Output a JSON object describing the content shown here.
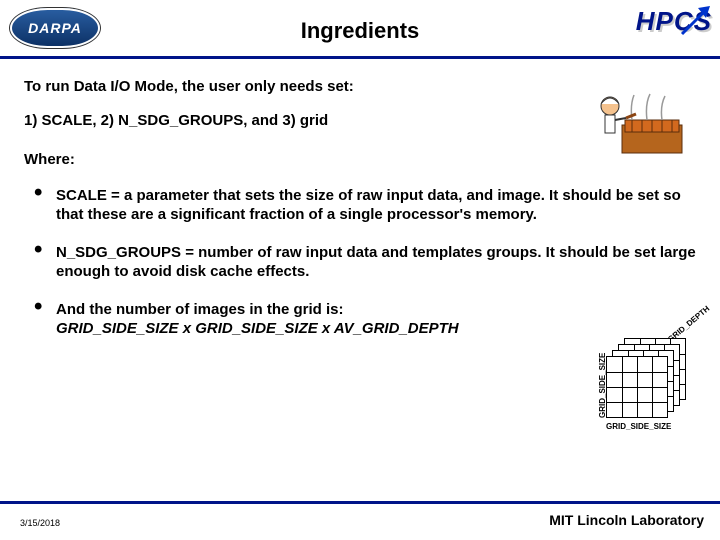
{
  "header": {
    "darpa_text": "DARPA",
    "title": "Ingredients",
    "hpcs_text": "HPCS"
  },
  "content": {
    "intro": "To run Data I/O Mode, the user only needs set:",
    "params": "1) SCALE,  2) N_SDG_GROUPS,  and 3) grid",
    "where": "Where:",
    "b1_head": "SCALE",
    "b1_body": " = a parameter that sets the size of raw input data, and image.  It should be set so that these are a significant fraction of a single processor's memory.",
    "b2_head": "N_SDG_GROUPS",
    "b2_body": " = number of raw input data and templates groups.  It should be set large enough to avoid disk cache effects.",
    "b3_intro": "And the number of images in the grid is:",
    "b3_formula": "GRID_SIDE_SIZE x GRID_SIDE_SIZE x AV_GRID_DEPTH"
  },
  "diagram": {
    "ylabel": "GRID_SIDE_SIZE",
    "xlabel": "GRID_SIDE_SIZE",
    "depth": "AV_GRID_DEPTH"
  },
  "footer": {
    "lab": "MIT Lincoln Laboratory",
    "date": "3/15/2018"
  }
}
